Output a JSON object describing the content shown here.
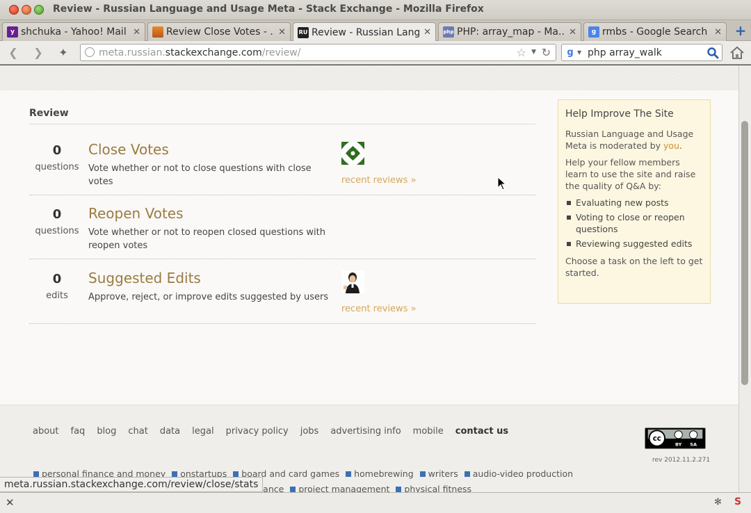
{
  "window": {
    "title": "Review - Russian Language and Usage Meta - Stack Exchange - Mozilla Firefox"
  },
  "tabs": [
    {
      "label": "shchuka - Yahoo! Mail",
      "icon": "yahoo-mail-icon",
      "active": false
    },
    {
      "label": "Review Close Votes - ...",
      "icon": "stackexchange-icon",
      "active": false
    },
    {
      "label": "Review - Russian Lang...",
      "icon": "russian-se-icon",
      "active": true
    },
    {
      "label": "PHP: array_map - Ma...",
      "icon": "php-icon",
      "active": false
    },
    {
      "label": "rmbs - Google Search",
      "icon": "google-icon",
      "active": false
    }
  ],
  "tab_icons": {
    "php": "php",
    "russian": "RU",
    "google": "g",
    "yahoo": "y"
  },
  "newtab_label": "+",
  "navbar": {
    "url_prefix": "meta.russian.",
    "url_host": "stackexchange.com",
    "url_path": "/review/",
    "search_value": "php array_walk",
    "search_engine_glyph": "g"
  },
  "page": {
    "heading": "Review",
    "queues": [
      {
        "count": "0",
        "unit": "questions",
        "title": "Close Votes",
        "description": "Vote whether or not to close questions with close votes",
        "recent": "recent reviews »"
      },
      {
        "count": "0",
        "unit": "questions",
        "title": "Reopen Votes",
        "description": "Vote whether or not to reopen closed questions with reopen votes",
        "recent": ""
      },
      {
        "count": "0",
        "unit": "edits",
        "title": "Suggested Edits",
        "description": "Approve, reject, or improve edits suggested by users",
        "recent": "recent reviews »"
      }
    ],
    "help": {
      "title": "Help Improve The Site",
      "p1_before": "Russian Language and Usage Meta is moderated by ",
      "p1_link": "you",
      "p1_after": ".",
      "p2": "Help your fellow members learn to use the site and raise the quality of Q&A by:",
      "items": [
        "Evaluating new posts",
        "Voting to close or reopen questions",
        "Reviewing suggested edits"
      ],
      "p3": "Choose a task on the left to get started."
    }
  },
  "footer": {
    "links": [
      "about",
      "faq",
      "blog",
      "chat",
      "data",
      "legal",
      "privacy policy",
      "jobs",
      "advertising info",
      "mobile",
      "contact us"
    ],
    "rev": "rev 2012.11.2.271",
    "license_badge": {
      "cc": "cc",
      "by": "BY",
      "sa": "SA"
    },
    "sites_row1": [
      "personal finance and money",
      "onstartups",
      "board and card games",
      "homebrewing",
      "writers",
      "audio-video production"
    ],
    "sites_row2_partial": "titative finance",
    "sites_row2": [
      "project management",
      "physical fitness"
    ]
  },
  "status": {
    "url": "meta.russian.stackexchange.com/review/close/stats"
  },
  "colors": {
    "queue_title": "#9a7b43",
    "recent_link": "#d7a75a",
    "help_bg": "#fdf7e2",
    "site_square": "#3b70b5"
  }
}
